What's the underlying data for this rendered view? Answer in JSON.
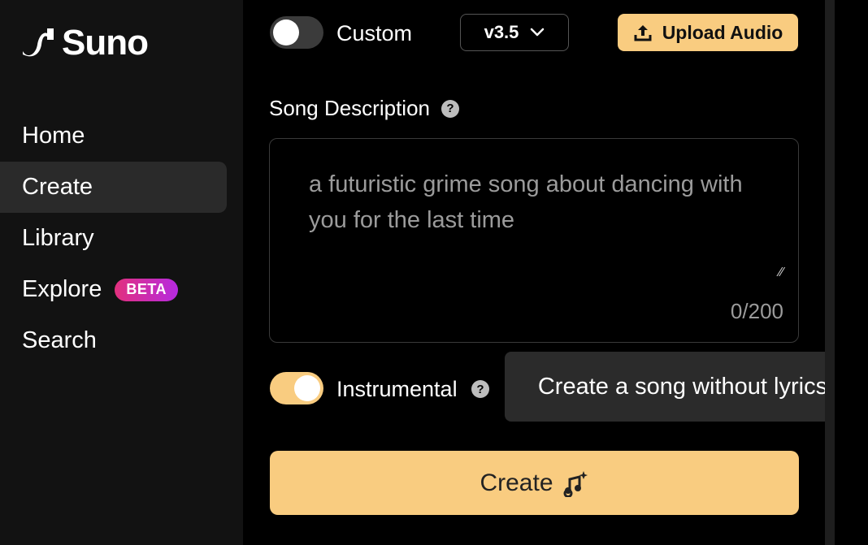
{
  "brand": {
    "name": "Suno"
  },
  "sidebar": {
    "items": [
      {
        "label": "Home",
        "active": false
      },
      {
        "label": "Create",
        "active": true
      },
      {
        "label": "Library",
        "active": false
      },
      {
        "label": "Explore",
        "active": false,
        "badge": "BETA"
      },
      {
        "label": "Search",
        "active": false
      }
    ]
  },
  "controls": {
    "custom_label": "Custom",
    "custom_on": false,
    "version": "v3.5",
    "upload_label": "Upload Audio"
  },
  "song_description": {
    "label": "Song Description",
    "placeholder": "a futuristic grime song about dancing with you for the last time",
    "counter": "0/200"
  },
  "instrumental": {
    "label": "Instrumental",
    "on": true,
    "tooltip": "Create a song without lyrics."
  },
  "create_button": {
    "label": "Create"
  },
  "colors": {
    "accent": "#f9cc80",
    "sidebar_bg": "#121212",
    "active_item_bg": "#2a2a2a",
    "badge_gradient_start": "#e2307d",
    "badge_gradient_end": "#b62ae0"
  }
}
